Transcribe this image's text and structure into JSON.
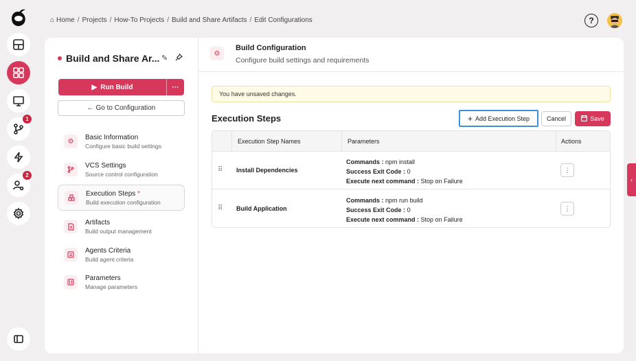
{
  "breadcrumb": {
    "home": "Home",
    "projects": "Projects",
    "howto": "How-To Projects",
    "project": "Build and Share Artifacts",
    "current": "Edit Configurations",
    "separator": "/"
  },
  "rail": {
    "badge_vcs": "1",
    "badge_users": "2",
    "active_item": "dashboard-grid"
  },
  "header_actions": {
    "help": "?"
  },
  "project": {
    "title": "Build and Share Ar..."
  },
  "left": {
    "run_build": "Run Build",
    "run_more": "···",
    "goto_config": "← Go to Configuration"
  },
  "nav": [
    {
      "title": "Basic Information",
      "sub": "Configure basic build settings",
      "icon": "gear-icon"
    },
    {
      "title": "VCS Settings",
      "sub": "Source control configuration",
      "icon": "branch-icon"
    },
    {
      "title": "Execution Steps",
      "star": "*",
      "sub": "Build execution configuration",
      "icon": "steps-icon"
    },
    {
      "title": "Artifacts",
      "sub": "Build output management",
      "icon": "file-icon"
    },
    {
      "title": "Agents Criteria",
      "sub": "Build agent criteria",
      "icon": "agent-icon"
    },
    {
      "title": "Parameters",
      "sub": "Manage parameters",
      "icon": "sliders-icon"
    }
  ],
  "right_head": {
    "title": "Build Configuration",
    "subtitle": "Configure build settings and requirements"
  },
  "alert": "You have unsaved changes.",
  "steps": {
    "title": "Execution Steps",
    "add": "Add Execution Step",
    "cancel": "Cancel",
    "save": "Save",
    "columns": [
      "Execution Step Names",
      "Parameters",
      "Actions"
    ],
    "rows": [
      {
        "name": "Install Dependencies",
        "commands_label": "Commands :",
        "commands": "npm install",
        "exit_label": "Success Exit Code :",
        "exit": "0",
        "next_label": "Execute next command :",
        "next": "Stop on Failure"
      },
      {
        "name": "Build Application",
        "commands_label": "Commands :",
        "commands": "npm run build",
        "exit_label": "Success Exit Code :",
        "exit": "0",
        "next_label": "Execute next command :",
        "next": "Stop on Failure"
      }
    ]
  },
  "colors": {
    "accent": "#d6385c",
    "focus": "#3b8ee0",
    "warning_bg": "#fffbe6"
  }
}
